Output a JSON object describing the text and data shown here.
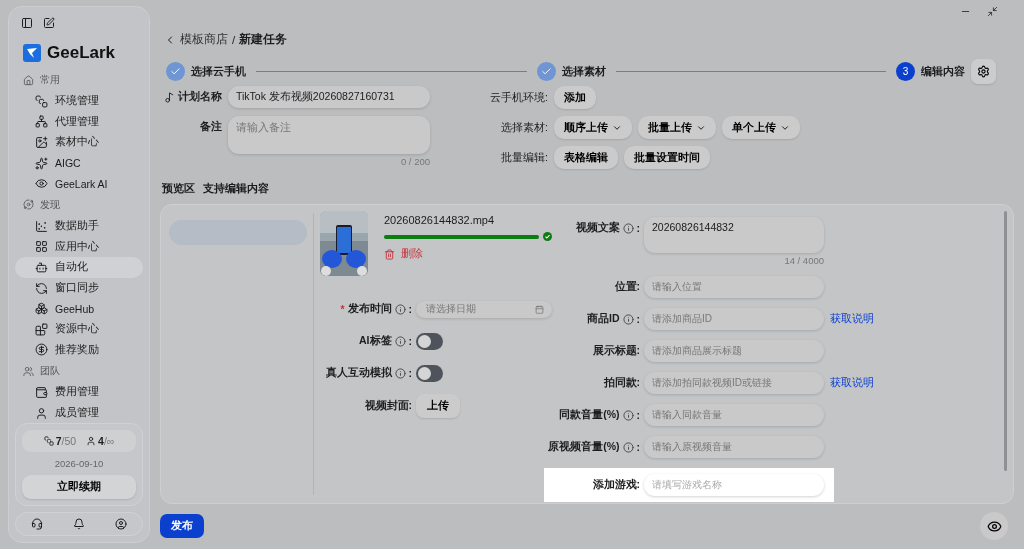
{
  "sidebar": {
    "brand": "GeeLark",
    "sections": [
      {
        "title": "常用",
        "items": [
          {
            "label": "环境管理",
            "selected": false
          },
          {
            "label": "代理管理",
            "selected": false
          },
          {
            "label": "素材中心",
            "selected": false
          },
          {
            "label": "AIGC",
            "selected": false
          },
          {
            "label": "GeeLark AI",
            "selected": false
          }
        ]
      },
      {
        "title": "发现",
        "items": [
          {
            "label": "数据助手",
            "selected": false
          },
          {
            "label": "应用中心",
            "selected": false
          },
          {
            "label": "自动化",
            "selected": true
          },
          {
            "label": "窗口同步",
            "selected": false
          },
          {
            "label": "GeeHub",
            "selected": false
          },
          {
            "label": "资源中心",
            "selected": false
          },
          {
            "label": "推荐奖励",
            "selected": false
          }
        ]
      },
      {
        "title": "团队",
        "items": [
          {
            "label": "费用管理",
            "selected": false
          },
          {
            "label": "成员管理",
            "selected": false
          }
        ]
      }
    ],
    "quota": {
      "devices_used": "7",
      "devices_total": "/50",
      "members_used": "4",
      "members_total": "/∞"
    },
    "expiry_date": "2026-09-10",
    "renew_button": "立即续期"
  },
  "breadcrumb": {
    "parent": "模板商店",
    "separator": "/",
    "current": "新建任务"
  },
  "steps": [
    {
      "label": "选择云手机",
      "completed": true
    },
    {
      "label": "选择素材",
      "completed": true
    },
    {
      "number": "3",
      "label": "编辑内容",
      "completed": false
    }
  ],
  "plan": {
    "name_label": "计划名称",
    "name_value": "TikTok 发布视频20260827160731",
    "note_label": "备注",
    "note_placeholder": "请输入备注",
    "note_counter": "0 / 200"
  },
  "config_rows": [
    {
      "label": "云手机环境:",
      "buttons": [
        {
          "label": "添加",
          "dropdown": false
        }
      ]
    },
    {
      "label": "选择素材:",
      "buttons": [
        {
          "label": "顺序上传",
          "dropdown": true
        },
        {
          "label": "批量上传",
          "dropdown": true
        },
        {
          "label": "单个上传",
          "dropdown": true
        }
      ]
    },
    {
      "label": "批量编辑:",
      "buttons": [
        {
          "label": "表格编辑",
          "dropdown": false
        },
        {
          "label": "批量设置时间",
          "dropdown": false
        }
      ]
    }
  ],
  "preview": {
    "title": "预览区",
    "subtitle": "支持编辑内容"
  },
  "video": {
    "filename": "20260826144832.mp4",
    "level": 1,
    "delete_label": "删除"
  },
  "left_fields": [
    {
      "kind": "date",
      "required_mark": "*",
      "label": "发布时间",
      "info": true,
      "colon": ":",
      "placeholder": "请选择日期"
    },
    {
      "kind": "toggle",
      "label": "AI标签",
      "info": true,
      "colon": ":",
      "on": false
    },
    {
      "kind": "toggle",
      "label": "真人互动模拟",
      "info": true,
      "colon": ":",
      "on": false
    },
    {
      "kind": "upload",
      "label": "视频封面:",
      "button": "上传"
    }
  ],
  "right_fields": [
    {
      "kind": "textarea",
      "label": "视频文案",
      "info": true,
      "colon": ":",
      "value": "20260826144832",
      "counter": "14 / 4000"
    },
    {
      "kind": "input",
      "label": "位置:",
      "placeholder": "请输入位置",
      "highlighted": false
    },
    {
      "kind": "input",
      "label": "商品ID",
      "info": true,
      "colon": ":",
      "placeholder": "请添加商品ID",
      "link": "获取说明",
      "highlighted": false
    },
    {
      "kind": "input",
      "label": "展示标题:",
      "placeholder": "请添加商品展示标题",
      "highlighted": false
    },
    {
      "kind": "input",
      "label": "拍同款:",
      "placeholder": "请添加拍同款视频ID或链接",
      "link": "获取说明",
      "highlighted": false
    },
    {
      "kind": "input",
      "label": "同款音量(%)",
      "info": true,
      "colon": ":",
      "placeholder": "请输入同款音量",
      "highlighted": false
    },
    {
      "kind": "input",
      "label": "原视频音量(%)",
      "info": true,
      "colon": ":",
      "placeholder": "请输入原视频音量",
      "highlighted": false
    },
    {
      "kind": "input",
      "label": "添加游戏:",
      "placeholder": "请填写游戏名称",
      "highlighted": true
    }
  ],
  "publish_button": "发布"
}
